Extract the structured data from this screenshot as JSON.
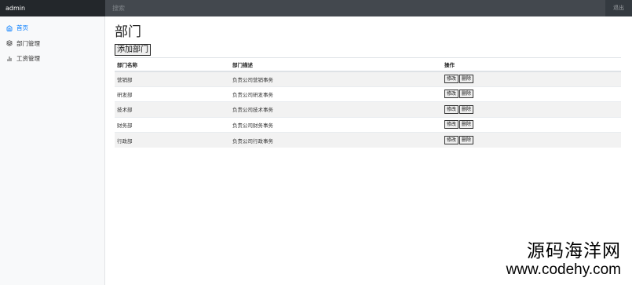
{
  "header": {
    "brand": "admin",
    "search_placeholder": "搜索",
    "logout_label": "退出"
  },
  "sidebar": {
    "items": [
      {
        "label": "首页",
        "icon": "home-icon",
        "active": true
      },
      {
        "label": "部门管理",
        "icon": "layers-icon",
        "active": false
      },
      {
        "label": "工资管理",
        "icon": "bar-chart-icon",
        "active": false
      }
    ]
  },
  "main": {
    "title": "部门",
    "add_button": "添加部门",
    "columns": [
      "部门名称",
      "部门描述",
      "操作"
    ],
    "rows": [
      {
        "name": "营销部",
        "desc": "负责公司营销事务"
      },
      {
        "name": "研发部",
        "desc": "负责公司研发事务"
      },
      {
        "name": "技术部",
        "desc": "负责公司技术事务"
      },
      {
        "name": "财务部",
        "desc": "负责公司财务事务"
      },
      {
        "name": "行政部",
        "desc": "负责公司行政事务"
      }
    ],
    "edit_label": "修改",
    "delete_label": "删除"
  },
  "watermark": {
    "line1": "源码海洋网",
    "line2": "www.codehy.com"
  },
  "colors": {
    "topbar": "#343a40",
    "brand_bg": "#23272b",
    "active_link": "#007bff",
    "sidebar_bg": "#f8f9fa"
  }
}
